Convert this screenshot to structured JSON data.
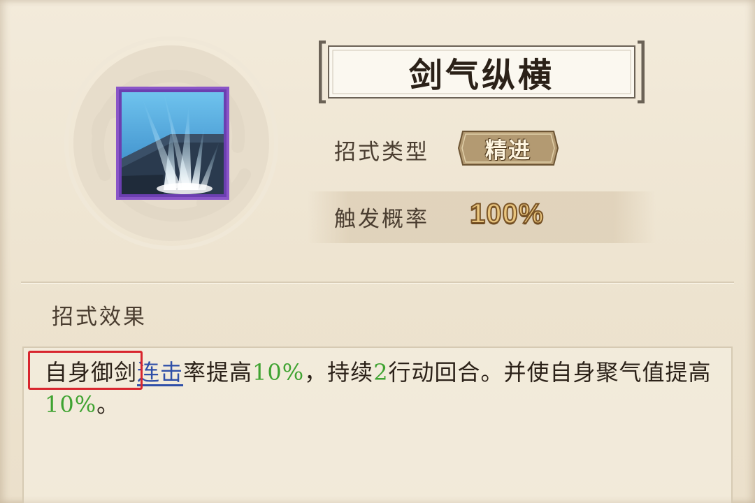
{
  "skill": {
    "name": "剑气纵横",
    "icon": "sword-qi-skill-icon"
  },
  "info": {
    "type_label": "招式类型",
    "type_value": "精进",
    "rate_label": "触发概率",
    "rate_value": "100%"
  },
  "effect": {
    "heading": "招式效果",
    "parts": {
      "p1": "自身御剑",
      "link": "连击",
      "p2": "率提高",
      "v1": "10%",
      "p3": "，持续",
      "v2": "2",
      "p4": "行动回合。并使自身聚气值提高",
      "v3": "10%",
      "p5": "。"
    }
  },
  "colors": {
    "value_green": "#3fa331",
    "link_blue": "#2f4fa8",
    "highlight_red": "#d8262e",
    "icon_border": "#8a55c8"
  }
}
